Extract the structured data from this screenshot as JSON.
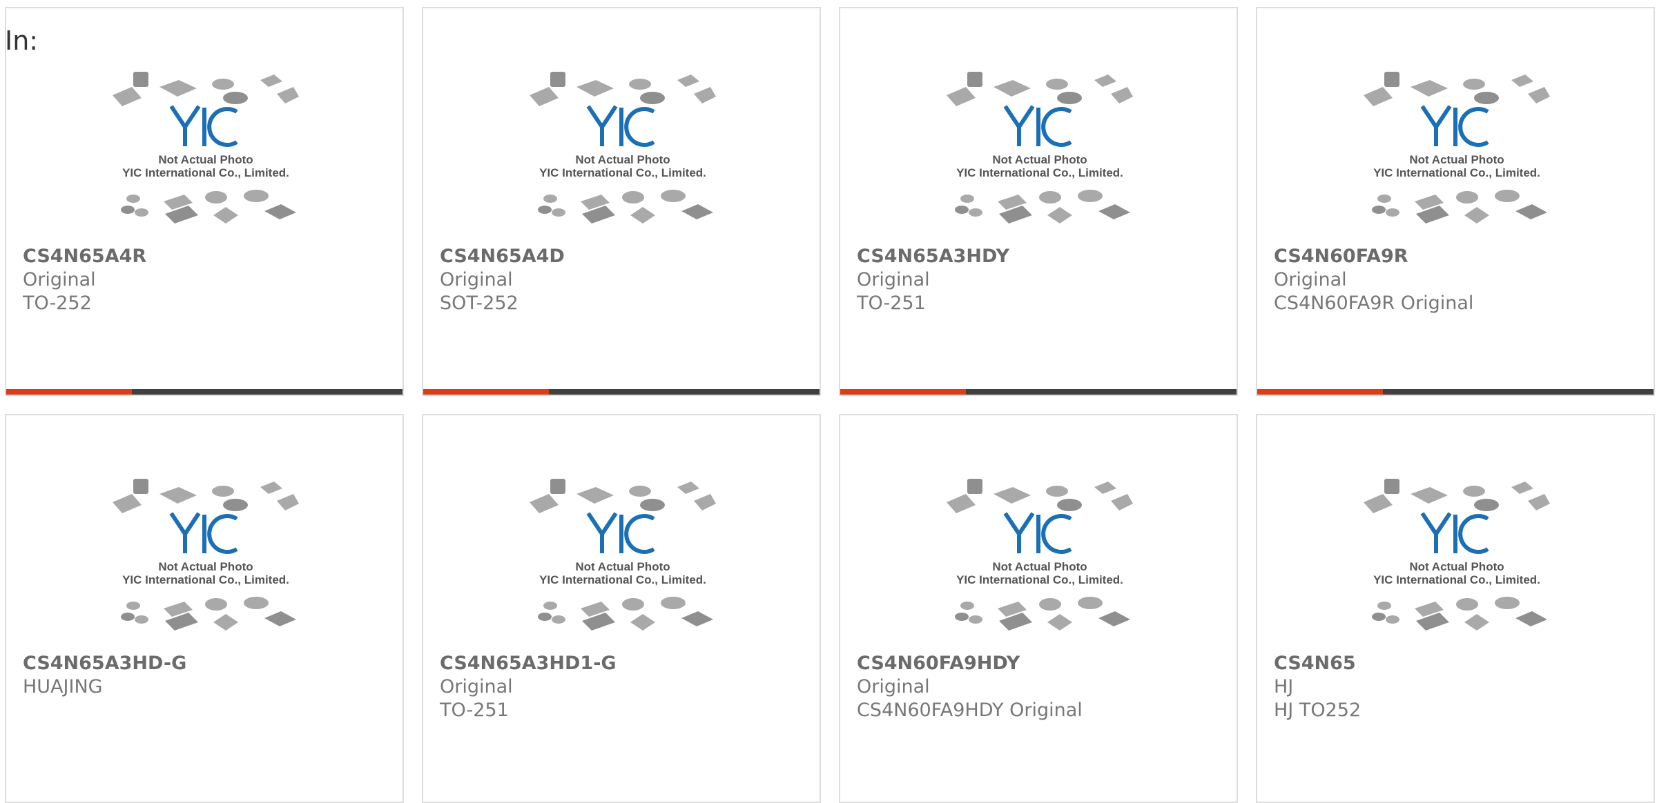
{
  "page": {
    "in_label": "In:"
  },
  "placeholder_image": {
    "line1": "Not Actual Photo",
    "line2": "YIC International Co., Limited.",
    "logo_text": "YIC",
    "logo_color": "#1a6fb5"
  },
  "colors": {
    "accent_bar": "#e03a16",
    "dark_bar": "#404040",
    "border": "#dddddd"
  },
  "products": [
    {
      "part": "CS4N65A4R",
      "line1": "Original",
      "line2": "TO-252"
    },
    {
      "part": "CS4N65A4D",
      "line1": "Original",
      "line2": "SOT-252"
    },
    {
      "part": "CS4N65A3HDY",
      "line1": "Original",
      "line2": "TO-251"
    },
    {
      "part": "CS4N60FA9R",
      "line1": "Original",
      "line2": "CS4N60FA9R Original"
    },
    {
      "part": "CS4N65A3HD-G",
      "line1": "HUAJING",
      "line2": ""
    },
    {
      "part": "CS4N65A3HD1-G",
      "line1": "Original",
      "line2": "TO-251"
    },
    {
      "part": "CS4N60FA9HDY",
      "line1": "Original",
      "line2": "CS4N60FA9HDY Original"
    },
    {
      "part": "CS4N65",
      "line1": "HJ",
      "line2": "HJ TO252"
    }
  ]
}
